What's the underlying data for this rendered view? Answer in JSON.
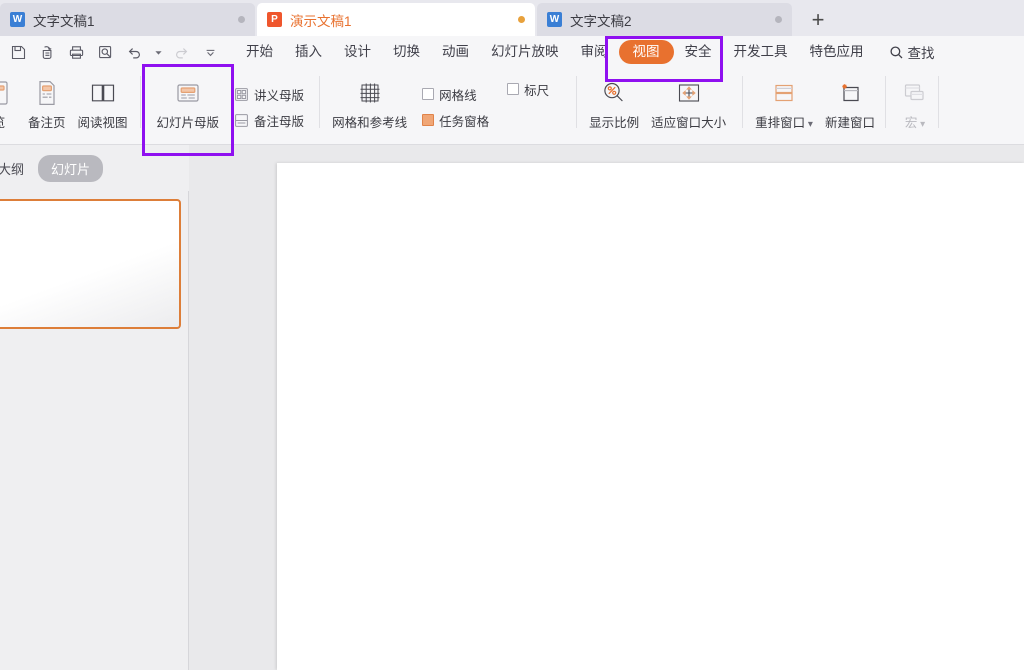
{
  "window": {
    "tabs": [
      {
        "label": "文字文稿1",
        "icon": "word-doc-icon",
        "icon_letter": "W",
        "icon_kind": "w",
        "active": false,
        "dot": "unsaved-dot"
      },
      {
        "label": "演示文稿1",
        "icon": "presentation-doc-icon",
        "icon_letter": "P",
        "icon_kind": "p",
        "active": true,
        "dot": "unsaved-dot"
      },
      {
        "label": "文字文稿2",
        "icon": "word-doc-icon",
        "icon_letter": "W",
        "icon_kind": "w",
        "active": false,
        "dot": "unsaved-dot"
      }
    ],
    "new_tab_label": "+"
  },
  "quick_access": [
    {
      "name": "save-button",
      "icon": "save-icon",
      "disabled": false
    },
    {
      "name": "cloud-sync-button",
      "icon": "cloud-sync-icon",
      "disabled": false
    },
    {
      "name": "print-button",
      "icon": "print-icon",
      "disabled": false
    },
    {
      "name": "print-preview-button",
      "icon": "print-preview-icon",
      "disabled": false
    },
    {
      "name": "undo-button",
      "icon": "undo-icon",
      "disabled": false
    },
    {
      "name": "undo-dropdown",
      "icon": "chevron-down-icon",
      "disabled": false
    },
    {
      "name": "redo-button",
      "icon": "redo-icon",
      "disabled": true
    },
    {
      "name": "customize-qat-button",
      "icon": "chevron-down-icon",
      "disabled": false
    }
  ],
  "ribbon_tabs": [
    {
      "label": "开始",
      "selected": false
    },
    {
      "label": "插入",
      "selected": false
    },
    {
      "label": "设计",
      "selected": false
    },
    {
      "label": "切换",
      "selected": false
    },
    {
      "label": "动画",
      "selected": false
    },
    {
      "label": "幻灯片放映",
      "selected": false
    },
    {
      "label": "审阅",
      "selected": false
    },
    {
      "label": "视图",
      "selected": true
    },
    {
      "label": "安全",
      "selected": false
    },
    {
      "label": "开发工具",
      "selected": false
    },
    {
      "label": "特色应用",
      "selected": false
    }
  ],
  "search": {
    "label": "查找",
    "icon": "search-icon"
  },
  "ribbon": {
    "view_buttons": [
      {
        "label": "览",
        "icon": "reading-layout-icon",
        "disabled": false,
        "clipped": true
      },
      {
        "label": "备注页",
        "icon": "notes-page-icon",
        "disabled": false
      },
      {
        "label": "阅读视图",
        "icon": "reading-view-icon",
        "disabled": false
      }
    ],
    "master_buttons": [
      {
        "label": "幻灯片母版",
        "icon": "slide-master-icon",
        "disabled": false,
        "highlighted": true
      }
    ],
    "master_stack": [
      {
        "label": "讲义母版",
        "icon": "handout-master-icon"
      },
      {
        "label": "备注母版",
        "icon": "notes-master-icon"
      }
    ],
    "grid_button": {
      "label": "网格和参考线",
      "icon": "grid-guides-icon"
    },
    "checkboxes": [
      {
        "label": "网格线",
        "checked": false
      },
      {
        "label": "任务窗格",
        "checked": true
      },
      {
        "label": "标尺",
        "checked": false
      }
    ],
    "zoom_buttons": [
      {
        "label": "显示比例",
        "icon": "zoom-percent-icon",
        "disabled": false
      },
      {
        "label": "适应窗口大小",
        "icon": "fit-to-window-icon",
        "disabled": false
      }
    ],
    "window_buttons": [
      {
        "label": "重排窗口",
        "icon": "arrange-windows-icon",
        "dropdown": true,
        "disabled": false
      },
      {
        "label": "新建窗口",
        "icon": "new-window-icon",
        "dropdown": false,
        "disabled": false
      }
    ],
    "macro_button": {
      "label": "宏",
      "icon": "macro-icon",
      "dropdown": true,
      "disabled": true
    }
  },
  "view_strip": {
    "outline_label": "大纲",
    "slides_pill": "幻灯片"
  },
  "slides": [
    {
      "index": 1,
      "selected": true,
      "content": ""
    }
  ],
  "colors": {
    "accent_orange": "#e8712f",
    "highlight_purple": "#8f10f0",
    "tabbar_bg": "#e8e8ee",
    "ribbon_bg": "#f6f6f8",
    "canvas_bg": "#e9e9eb",
    "slide_bg": "#ffffff",
    "thumb_border": "#dd7e39",
    "checkbox_on": "#f0a676",
    "word_icon": "#3a7fd5",
    "ppt_icon": "#ef562d"
  }
}
